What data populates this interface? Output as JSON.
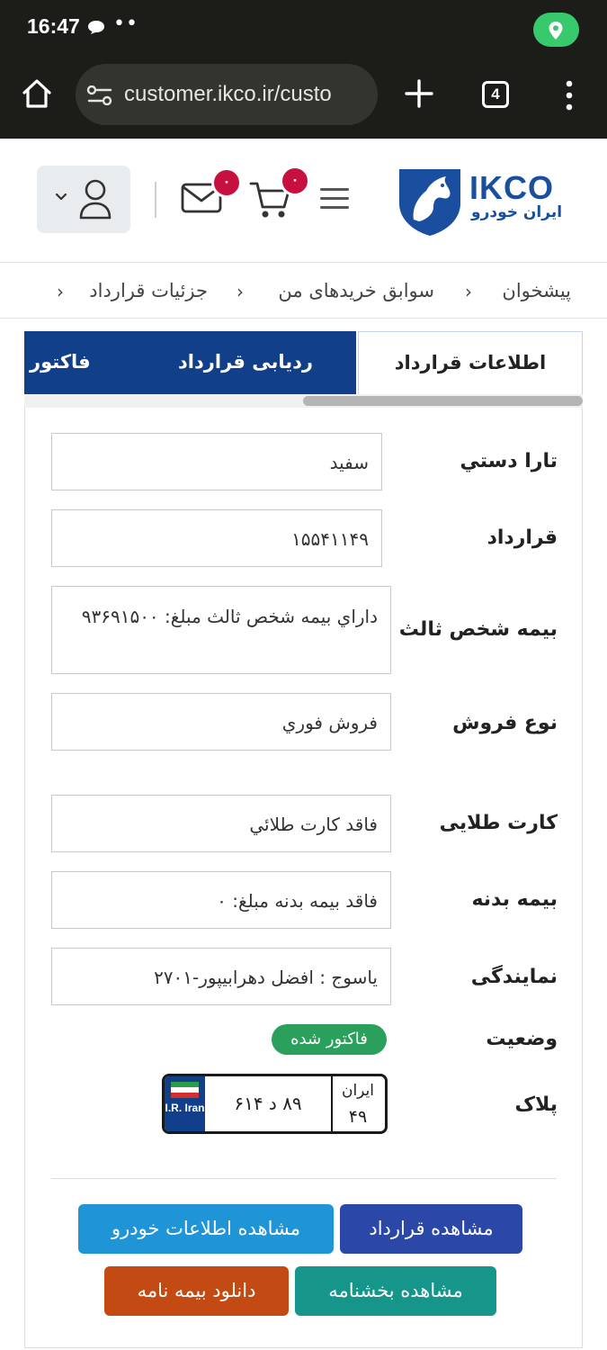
{
  "status_bar": {
    "time": "16:47",
    "dots": "••"
  },
  "browser": {
    "url": "customer.ikco.ir/custo",
    "tab_count": "4"
  },
  "header": {
    "logo_text": "IKCO",
    "logo_subtext": "ایران خودرو",
    "mail_badge": "۰",
    "cart_badge": "۰",
    "brand_color": "#1a4fa0",
    "badge_color": "#c8103e"
  },
  "breadcrumb": {
    "items": [
      "پیشخوان",
      "سوابق خریدهای من",
      "جزئیات قرارداد"
    ]
  },
  "tabs": [
    "اطلاعات قرارداد",
    "ردیابی قرارداد",
    "فاکتور"
  ],
  "details": {
    "rows": [
      {
        "label": "تارا دستي",
        "value": "سفید"
      },
      {
        "label": "قرارداد",
        "value": "۱۵۵۴۱۱۴۹"
      },
      {
        "label": "بیمه شخص ثالث",
        "value": "داراي بیمه شخص ثالث مبلغ: ۹۳۶۹۱۵۰۰"
      },
      {
        "label": "نوع فروش",
        "value": "فروش فوري"
      },
      {
        "label": "کارت طلایی",
        "value": "فاقد کارت طلائي"
      },
      {
        "label": "بیمه بدنه",
        "value": "فاقد بیمه بدنه مبلغ: ۰"
      },
      {
        "label": "نمایندگی",
        "value": "یاسوج : افضل دهرابیپور-۲۷۰۱"
      }
    ],
    "status_label": "وضعیت",
    "status_value": "فاکتور شده",
    "plate_label": "پلاک",
    "plate": {
      "number": "۸۹ د ۶۱۴",
      "region_label": "ایران",
      "region_code": "۴۹",
      "country_code": "I.R. Iran"
    }
  },
  "actions": {
    "view_contract": "مشاهده قرارداد",
    "view_vehicle": "مشاهده اطلاعات خودرو",
    "view_bulletin": "مشاهده بخشنامه",
    "download_insurance": "دانلود بیمه نامه"
  }
}
